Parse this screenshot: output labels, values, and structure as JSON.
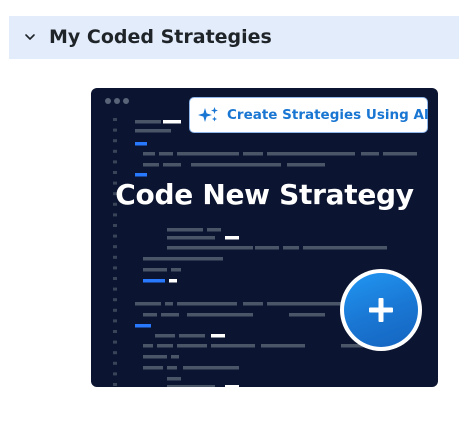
{
  "section": {
    "title": "My Coded Strategies",
    "expanded": true,
    "chevron_icon": "chevron-down-icon"
  },
  "card": {
    "title": "Code New Strategy",
    "ai_button_label": "Create Strategies Using AI",
    "ai_icon": "sparkles-icon",
    "add_icon": "plus-icon",
    "colors": {
      "card_background": "#0b1430",
      "accent_blue": "#1976d2",
      "header_background": "#e3ecfb"
    }
  }
}
